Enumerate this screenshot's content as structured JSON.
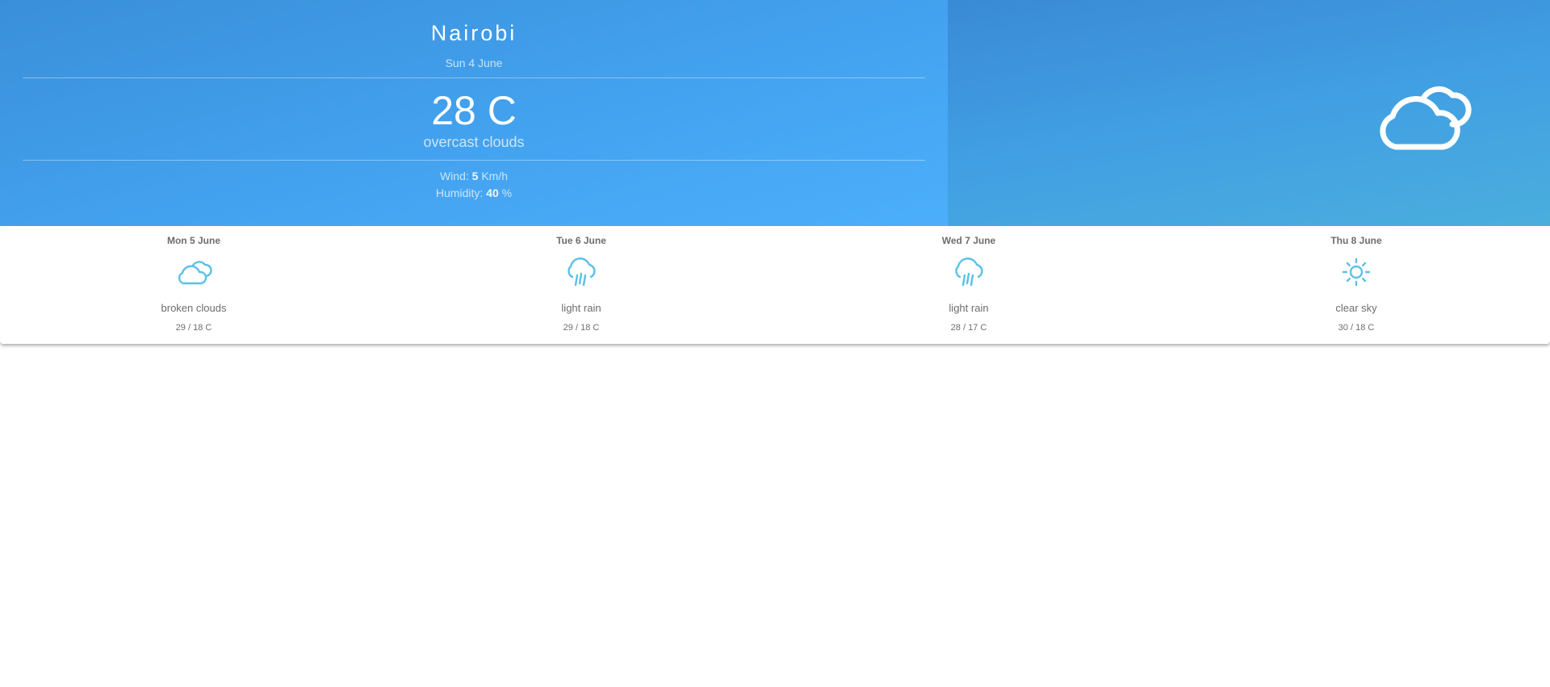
{
  "current": {
    "city": "Nairobi",
    "date": "Sun 4 June",
    "temperature": "28 C",
    "description": "overcast clouds",
    "wind_label": "Wind:",
    "wind_value": "5",
    "wind_unit": "Km/h",
    "humidity_label": "Humidity:",
    "humidity_value": "40",
    "humidity_unit": "%",
    "icon": "overcast-clouds-icon"
  },
  "forecast": [
    {
      "day": "Mon 5 June",
      "icon": "broken-clouds-icon",
      "description": "broken clouds",
      "temps": "29 / 18 C"
    },
    {
      "day": "Tue 6 June",
      "icon": "light-rain-icon",
      "description": "light rain",
      "temps": "29 / 18 C"
    },
    {
      "day": "Wed 7 June",
      "icon": "light-rain-icon",
      "description": "light rain",
      "temps": "28 / 17 C"
    },
    {
      "day": "Thu 8 June",
      "icon": "clear-sky-icon",
      "description": "clear sky",
      "temps": "30 / 18 C"
    }
  ],
  "colors": {
    "hero_blue": "#43a2ef",
    "icon_blue": "#5bc0e8",
    "text_gray": "#6d6d6d"
  }
}
